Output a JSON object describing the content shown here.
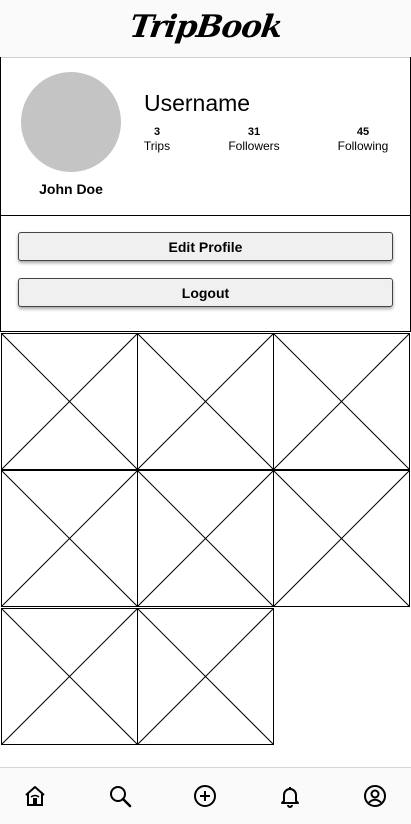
{
  "app": {
    "logo_text": "TripBook"
  },
  "profile": {
    "username": "Username",
    "full_name": "John Doe",
    "stats": [
      {
        "value": "3",
        "label": "Trips"
      },
      {
        "value": "31",
        "label": "Followers"
      },
      {
        "value": "45",
        "label": "Following"
      }
    ]
  },
  "actions": {
    "edit_profile_label": "Edit Profile",
    "logout_label": "Logout"
  },
  "trip_grid": {
    "tile_count": 8
  },
  "bottom_nav": {
    "items": [
      {
        "icon": "home-icon"
      },
      {
        "icon": "search-icon"
      },
      {
        "icon": "add-circle-icon"
      },
      {
        "icon": "bell-icon"
      },
      {
        "icon": "account-circle-icon"
      }
    ]
  },
  "colors": {
    "avatar_placeholder": "#c4c4c4",
    "button_bg": "#f0f0f0"
  }
}
